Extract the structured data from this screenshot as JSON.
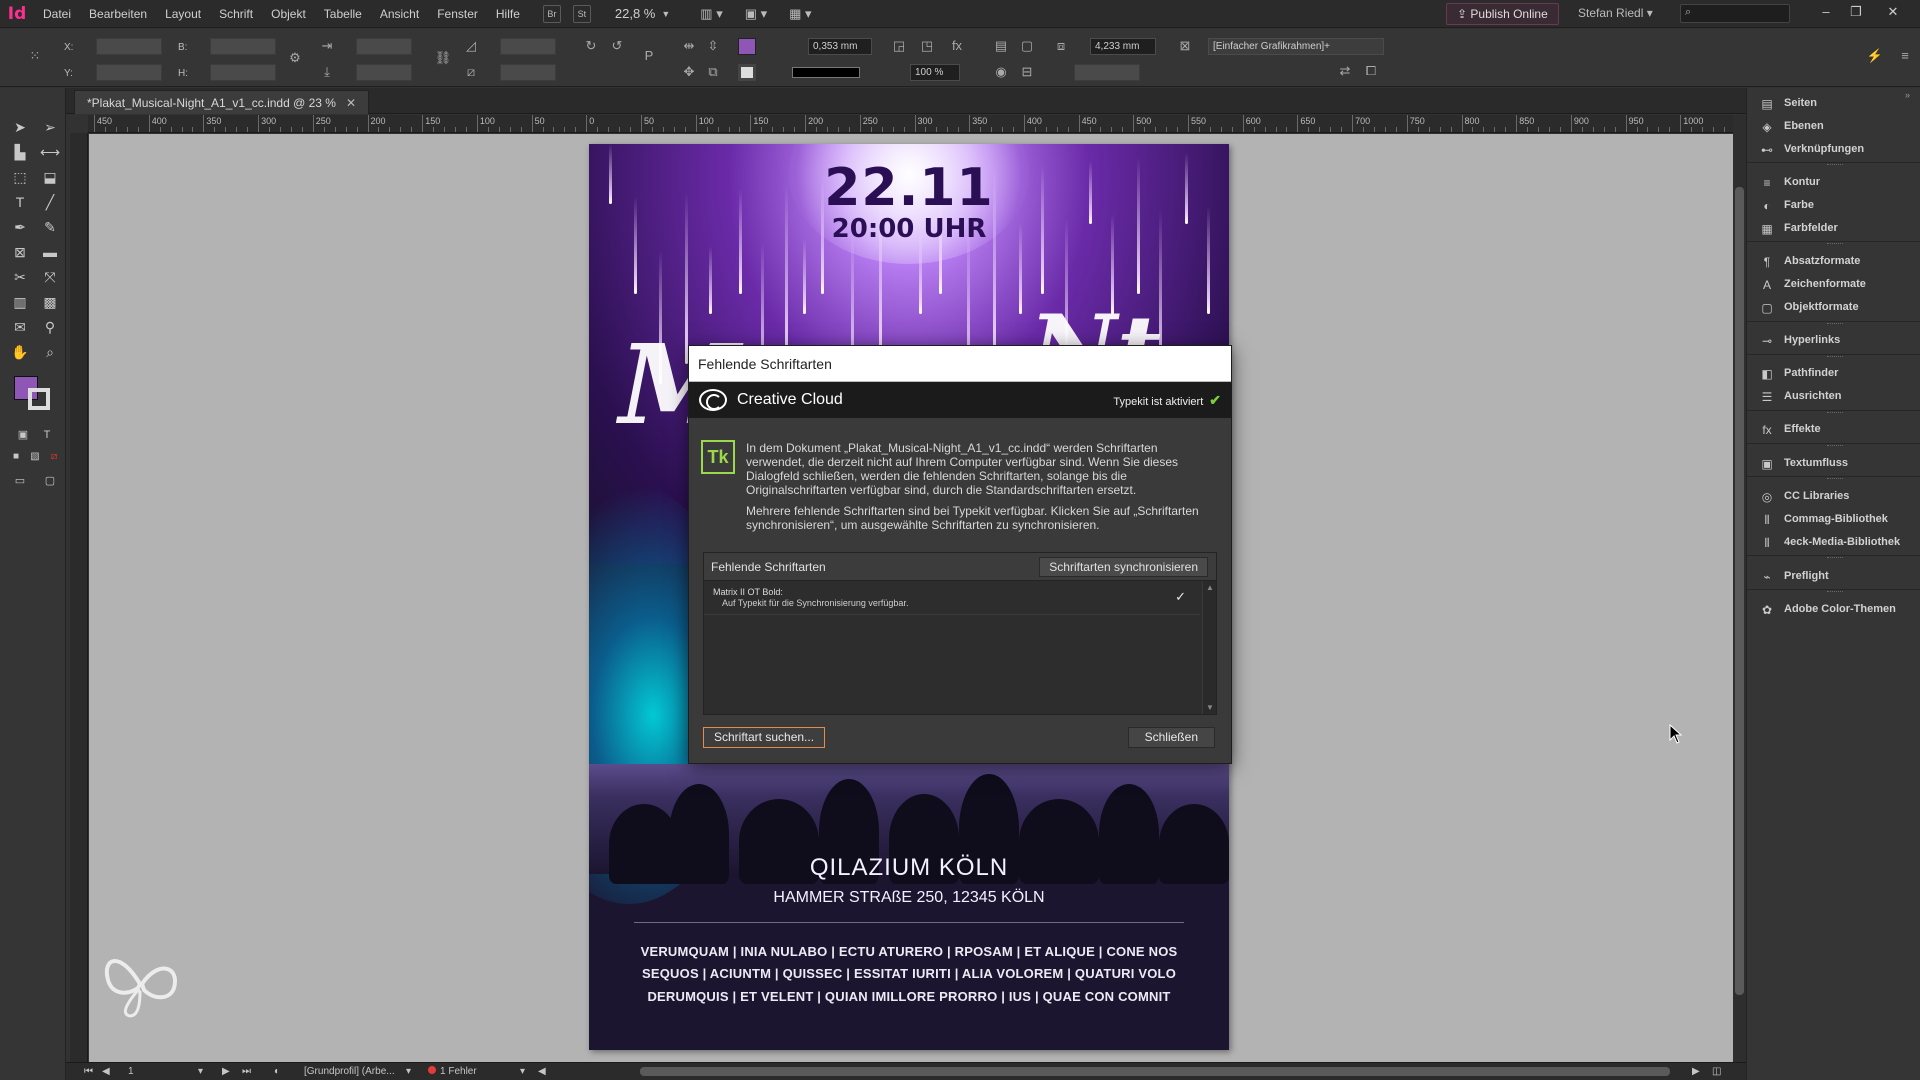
{
  "app": {
    "logo": "Id",
    "menus": [
      "Datei",
      "Bearbeiten",
      "Layout",
      "Schrift",
      "Objekt",
      "Tabelle",
      "Ansicht",
      "Fenster",
      "Hilfe"
    ],
    "bridge_btn": "Br",
    "stock_btn": "St",
    "zoom": "22,8 %",
    "publish_label": "Publish Online",
    "user": "Stefan Riedl"
  },
  "controlbar": {
    "x_label": "X:",
    "y_label": "Y:",
    "b_label": "B:",
    "h_label": "H:",
    "stroke_weight": "0,353 mm",
    "opacity": "100 %",
    "spacing": "4,233 mm",
    "frame_style": "[Einfacher Grafikrahmen]+"
  },
  "document": {
    "tab_title": "*Plakat_Musical-Night_A1_v1_cc.indd @ 23 %",
    "ruler_labels": [
      "450",
      "400",
      "350",
      "300",
      "250",
      "200",
      "150",
      "100",
      "50",
      "0",
      "50",
      "100",
      "150",
      "200",
      "250",
      "300",
      "350",
      "400",
      "450",
      "500",
      "550",
      "600",
      "650",
      "700",
      "750",
      "800",
      "850",
      "900",
      "950",
      "1000"
    ]
  },
  "poster": {
    "date": "22.11",
    "time": "20:00 UHR",
    "venue_name": "QILAZIUM KÖLN",
    "venue_address": "HAMMER STRAßE 250, 12345 KÖLN",
    "lines": [
      "VERUMQUAM | INIA NULABO | ECTU ATURERO | RPOSAM | ET ALIQUE | CONE NOS",
      "SEQUOS | ACIUNTM | QUISSEC | ESSITAT IURITI | ALIA VOLOREM | QUATURI VOLO",
      "DERUMQUIS | ET VELENT | QUIAN IMILLORE PRORRO | IUS | QUAE CON COMNIT"
    ]
  },
  "dialog": {
    "title": "Fehlende Schriftarten",
    "cc_title": "Creative Cloud",
    "typekit_status": "Typekit ist aktiviert",
    "tk_badge": "Tk",
    "para1": "In dem Dokument „Plakat_Musical-Night_A1_v1_cc.indd“ werden Schriftarten verwendet, die derzeit nicht auf Ihrem Computer verfügbar sind. Wenn Sie dieses Dialogfeld schließen, werden die fehlenden Schriftarten, solange bis die Originalschriftarten verfügbar sind, durch die Standardschriftarten ersetzt.",
    "para2": "Mehrere fehlende Schriftarten sind bei Typekit verfügbar. Klicken Sie auf „Schriftarten synchronisieren“, um ausgewählte Schriftarten zu synchronisieren.",
    "table_label": "Fehlende Schriftarten",
    "sync_button": "Schriftarten synchronisieren",
    "fonts": [
      {
        "name": "Matrix II OT Bold:",
        "note": "Auf Typekit für die Synchronisierung verfügbar.",
        "checked": true
      }
    ],
    "find_button": "Schriftart suchen...",
    "close_button": "Schließen"
  },
  "panels": [
    {
      "icon": "pages-icon",
      "label": "Seiten",
      "glyph": "▤"
    },
    {
      "icon": "layers-icon",
      "label": "Ebenen",
      "glyph": "◈"
    },
    {
      "icon": "links-icon",
      "label": "Verknüpfungen",
      "glyph": "⊷"
    },
    {
      "icon": "stroke-icon",
      "label": "Kontur",
      "glyph": "≡"
    },
    {
      "icon": "color-icon",
      "label": "Farbe",
      "glyph": "◐"
    },
    {
      "icon": "swatches-icon",
      "label": "Farbfelder",
      "glyph": "▦"
    },
    {
      "icon": "paragraph-styles-icon",
      "label": "Absatzformate",
      "glyph": "¶"
    },
    {
      "icon": "character-styles-icon",
      "label": "Zeichenformate",
      "glyph": "A"
    },
    {
      "icon": "object-styles-icon",
      "label": "Objektformate",
      "glyph": "▢"
    },
    {
      "icon": "hyperlinks-icon",
      "label": "Hyperlinks",
      "glyph": "⊸"
    },
    {
      "icon": "pathfinder-icon",
      "label": "Pathfinder",
      "glyph": "◧"
    },
    {
      "icon": "align-icon",
      "label": "Ausrichten",
      "glyph": "☰"
    },
    {
      "icon": "effects-icon",
      "label": "Effekte",
      "glyph": "fx"
    },
    {
      "icon": "text-wrap-icon",
      "label": "Textumfluss",
      "glyph": "▣"
    },
    {
      "icon": "cc-libraries-icon",
      "label": "CC Libraries",
      "glyph": "◎"
    },
    {
      "icon": "library-icon",
      "label": "Commag-Bibliothek",
      "glyph": "⫴"
    },
    {
      "icon": "library-icon",
      "label": "4eck-Media-Bibliothek",
      "glyph": "⫴"
    },
    {
      "icon": "preflight-icon",
      "label": "Preflight",
      "glyph": "⌁"
    },
    {
      "icon": "color-themes-icon",
      "label": "Adobe Color-Themen",
      "glyph": "✿"
    }
  ],
  "statusbar": {
    "page": "1",
    "profile": "[Grundprofil] (Arbe...",
    "errors": "1 Fehler"
  }
}
